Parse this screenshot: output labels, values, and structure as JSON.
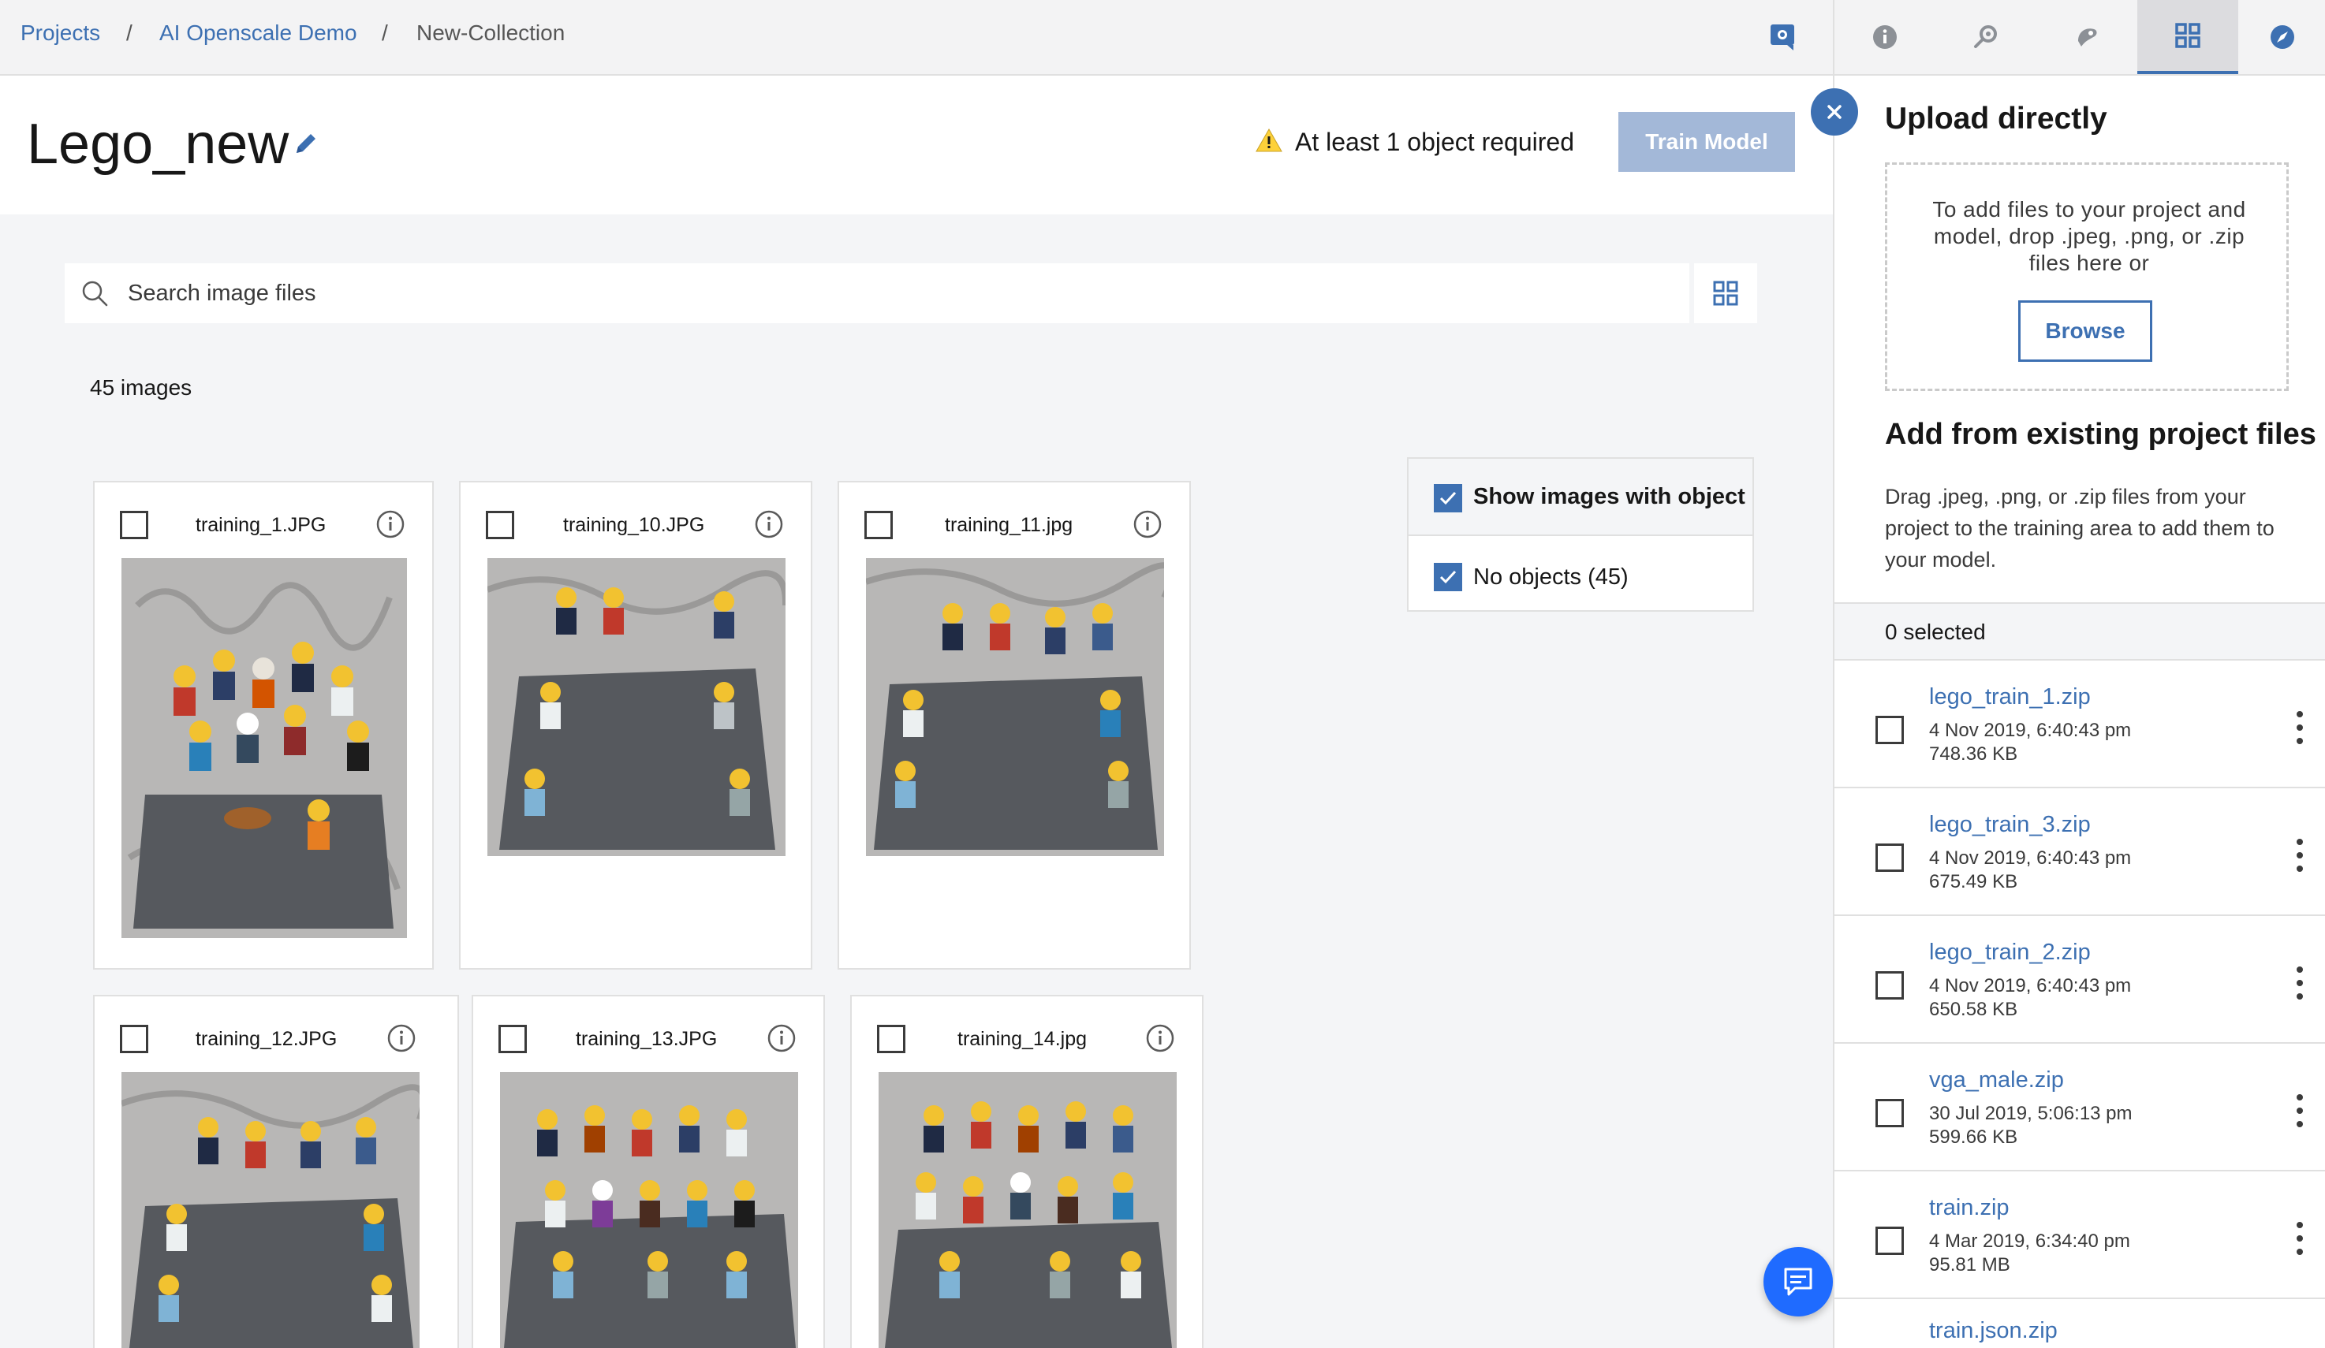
{
  "breadcrumb": {
    "items": [
      "Projects",
      "AI Openscale Demo",
      "New-Collection"
    ],
    "separator": "/"
  },
  "header": {
    "title": "Lego_new",
    "warning_text": "At least 1 object required",
    "train_button": "Train Model"
  },
  "search": {
    "placeholder": "Search image files",
    "value": ""
  },
  "image_count": "45 images",
  "images": [
    {
      "filename": "training_1.JPG"
    },
    {
      "filename": "training_10.JPG"
    },
    {
      "filename": "training_11.jpg"
    },
    {
      "filename": "training_12.JPG"
    },
    {
      "filename": "training_13.JPG"
    },
    {
      "filename": "training_14.jpg"
    }
  ],
  "filter": {
    "header_label": "Show images with object",
    "header_checked": true,
    "items": [
      {
        "label": "No objects (45)",
        "checked": true
      }
    ]
  },
  "upload_panel": {
    "title": "Upload directly",
    "dropzone_text": "To add files to your project and model, drop .jpeg, .png, or .zip files here or",
    "browse_label": "Browse",
    "existing_title": "Add from existing project files",
    "existing_desc": "Drag .jpeg, .png, or .zip files from your project to the training area to add them to your model.",
    "selected_text": "0 selected",
    "files": [
      {
        "name": "lego_train_1.zip",
        "date": "4 Nov 2019, 6:40:43 pm",
        "size": "748.36 KB"
      },
      {
        "name": "lego_train_3.zip",
        "date": "4 Nov 2019, 6:40:43 pm",
        "size": "675.49 KB"
      },
      {
        "name": "lego_train_2.zip",
        "date": "4 Nov 2019, 6:40:43 pm",
        "size": "650.58 KB"
      },
      {
        "name": "vga_male.zip",
        "date": "30 Jul 2019, 5:06:13 pm",
        "size": "599.66 KB"
      },
      {
        "name": "train.zip",
        "date": "4 Mar 2019, 6:34:40 pm",
        "size": "95.81 MB"
      },
      {
        "name": "train.json.zip",
        "date": "",
        "size": ""
      }
    ]
  },
  "icons": {
    "toolbar": [
      "notebook-icon"
    ],
    "side_tabs": [
      "info-icon",
      "data-search-icon",
      "model-icon",
      "grid-icon",
      "compass-icon"
    ],
    "active_side_tab": "grid-icon"
  },
  "colors": {
    "link": "#3d70b2",
    "train_button_disabled": "#a3b8d8",
    "warning": "#fdd13a",
    "chat": "#1f6bff"
  }
}
